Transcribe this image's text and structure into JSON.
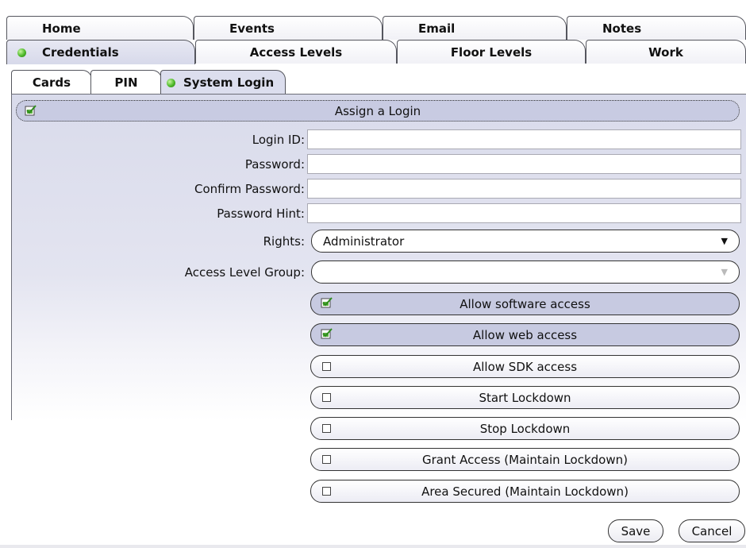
{
  "main_tabs_row1": [
    "Home",
    "Events",
    "Email",
    "Notes"
  ],
  "main_tabs_row2": [
    "Credentials",
    "Access Levels",
    "Floor Levels",
    "Work"
  ],
  "sub_tabs": [
    "Cards",
    "PIN",
    "System Login"
  ],
  "assign_login": {
    "label": "Assign a Login",
    "checked": true
  },
  "form": {
    "login_id": {
      "label": "Login ID:",
      "value": ""
    },
    "password": {
      "label": "Password:",
      "value": ""
    },
    "confirm_password": {
      "label": "Confirm Password:",
      "value": ""
    },
    "password_hint": {
      "label": "Password Hint:",
      "value": ""
    },
    "rights": {
      "label": "Rights:",
      "value": "Administrator"
    },
    "access_level_group": {
      "label": "Access Level Group:",
      "value": ""
    }
  },
  "options": [
    {
      "label": "Allow software access",
      "checked": true
    },
    {
      "label": "Allow web access",
      "checked": true
    },
    {
      "label": "Allow SDK access",
      "checked": false
    },
    {
      "label": "Start Lockdown",
      "checked": false
    },
    {
      "label": "Stop Lockdown",
      "checked": false
    },
    {
      "label": "Grant Access (Maintain Lockdown)",
      "checked": false
    },
    {
      "label": "Area Secured (Maintain Lockdown)",
      "checked": false
    }
  ],
  "buttons": {
    "save": "Save",
    "cancel": "Cancel"
  },
  "colors": {
    "panel": "#d9dbeb",
    "active_tab": "#dcdeee",
    "checked_option": "#c7cae1",
    "status_dot": "#4db82a"
  }
}
